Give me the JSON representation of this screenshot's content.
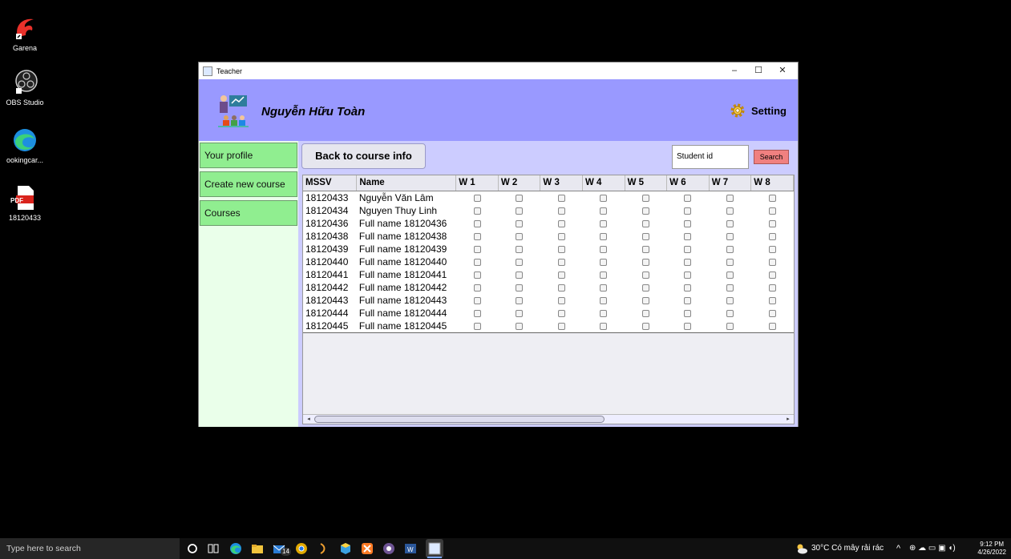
{
  "desktop": {
    "icons": [
      {
        "label": "Garena"
      },
      {
        "label": "OBS Studio"
      },
      {
        "label": "ookingcar..."
      },
      {
        "label": "18120433",
        "badge": "PDF"
      }
    ]
  },
  "window": {
    "title": "Teacher",
    "controls": {
      "minimize": "–",
      "maximize": "☐",
      "close": "✕"
    },
    "header": {
      "teacher_name": "Nguyễn Hữu Toàn",
      "setting_label": "Setting"
    },
    "sidebar": {
      "items": [
        {
          "label": "Your profile"
        },
        {
          "label": "Create new course"
        },
        {
          "label": "Courses"
        }
      ]
    },
    "toolbar": {
      "back_label": "Back to course info",
      "search_value": "Student id",
      "search_button": "Search"
    },
    "table": {
      "headers": [
        "MSSV",
        "Name",
        "W 1",
        "W 2",
        "W 3",
        "W 4",
        "W 5",
        "W 6",
        "W 7",
        "W 8"
      ],
      "rows": [
        {
          "mssv": "18120433",
          "name": "Nguyễn Văn Lâm"
        },
        {
          "mssv": "18120434",
          "name": "Nguyen Thuy Linh"
        },
        {
          "mssv": "18120436",
          "name": "Full name 18120436"
        },
        {
          "mssv": "18120438",
          "name": "Full name 18120438"
        },
        {
          "mssv": "18120439",
          "name": "Full name 18120439"
        },
        {
          "mssv": "18120440",
          "name": "Full name 18120440"
        },
        {
          "mssv": "18120441",
          "name": "Full name 18120441"
        },
        {
          "mssv": "18120442",
          "name": "Full name 18120442"
        },
        {
          "mssv": "18120443",
          "name": "Full name 18120443"
        },
        {
          "mssv": "18120444",
          "name": "Full name 18120444"
        },
        {
          "mssv": "18120445",
          "name": "Full name 18120445"
        }
      ]
    }
  },
  "taskbar": {
    "search_placeholder": "Type here to search",
    "mail_badge": "14",
    "weather": "30°C  Có mây rải rác",
    "time": "9:12 PM",
    "date": "4/26/2022"
  },
  "colors": {
    "header_bg": "#9999ff",
    "main_bg": "#ccccff",
    "sidebar_bg": "#eaffea",
    "sidebar_btn": "#90ee90",
    "search_btn": "#f08080"
  }
}
